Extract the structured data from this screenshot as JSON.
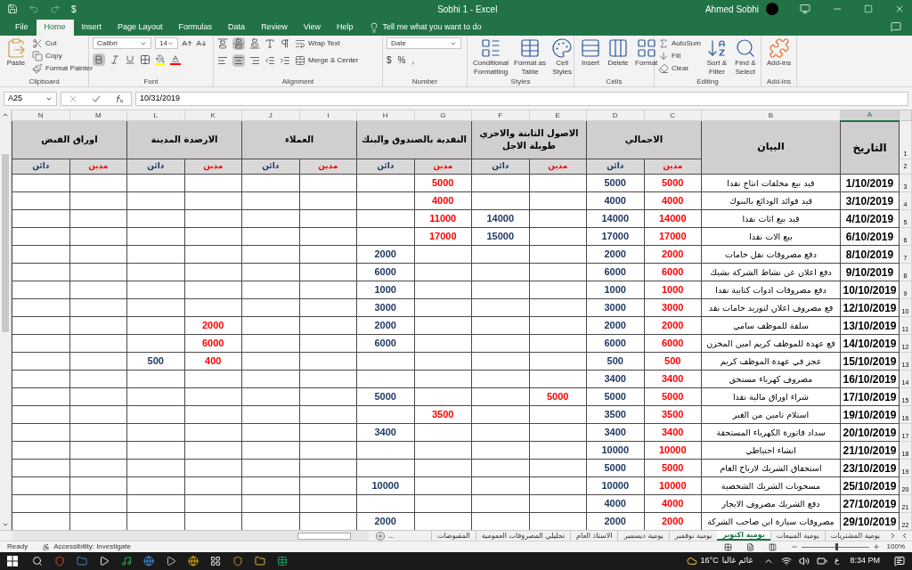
{
  "title_bar": {
    "currency_button": "$",
    "title": "Sobhi 1  -  Excel",
    "user": "Ahmed Sobhi"
  },
  "menu_tabs": [
    {
      "label": "File",
      "selected": false
    },
    {
      "label": "Home",
      "selected": true
    },
    {
      "label": "Insert",
      "selected": false
    },
    {
      "label": "Page Layout",
      "selected": false
    },
    {
      "label": "Formulas",
      "selected": false
    },
    {
      "label": "Data",
      "selected": false
    },
    {
      "label": "Review",
      "selected": false
    },
    {
      "label": "View",
      "selected": false
    },
    {
      "label": "Help",
      "selected": false
    }
  ],
  "tell_me": "Tell me what you want to do",
  "ribbon": {
    "clipboard": {
      "label": "Clipboard",
      "paste": "Paste",
      "cut": "Cut",
      "copy": "Copy",
      "format_painter": "Format Painter"
    },
    "font": {
      "label": "Font",
      "font_name": "Calibri",
      "font_size": "14",
      "bold": true
    },
    "alignment": {
      "label": "Alignment",
      "wrap_text": "Wrap Text",
      "merge_center": "Merge & Center",
      "align_middle": true,
      "align_center": true
    },
    "number": {
      "label": "Number",
      "format": "Date",
      "symbols": [
        "$",
        "%",
        ","
      ]
    },
    "styles": {
      "label": "Styles",
      "buttons": [
        [
          "Conditional",
          "Formatting"
        ],
        [
          "Format as",
          "Table"
        ],
        [
          "Cell",
          "Styles"
        ]
      ]
    },
    "cells": {
      "label": "Cells",
      "buttons": [
        "Insert",
        "Delete",
        "Format"
      ]
    },
    "editing": {
      "label": "Editing",
      "autosum": "AutoSum",
      "fill": "Fill",
      "clear": "Clear",
      "sort_filter": [
        "Sort &",
        "Filter"
      ],
      "find_select": [
        "Find &",
        "Select"
      ]
    },
    "addins": {
      "label": "Add-ins",
      "button": "Add-ins"
    }
  },
  "formula_bar": {
    "name_box": "A25",
    "value": "10/31/2019"
  },
  "sheet": {
    "columns": [
      {
        "letter": "N",
        "kind": "amount",
        "selected": false
      },
      {
        "letter": "M",
        "kind": "amount",
        "selected": false
      },
      {
        "letter": "L",
        "kind": "amount",
        "selected": false
      },
      {
        "letter": "K",
        "kind": "amount",
        "selected": false
      },
      {
        "letter": "J",
        "kind": "amount",
        "selected": false
      },
      {
        "letter": "I",
        "kind": "amount",
        "selected": false
      },
      {
        "letter": "H",
        "kind": "amount",
        "selected": false
      },
      {
        "letter": "G",
        "kind": "amount",
        "selected": false
      },
      {
        "letter": "F",
        "kind": "amount",
        "selected": false
      },
      {
        "letter": "E",
        "kind": "amount",
        "selected": false
      },
      {
        "letter": "D",
        "kind": "amount",
        "selected": false
      },
      {
        "letter": "C",
        "kind": "amount",
        "selected": false
      },
      {
        "letter": "B",
        "kind": "description",
        "selected": false
      },
      {
        "letter": "A",
        "kind": "date",
        "selected": true
      }
    ],
    "header_rows": [
      "1",
      "2"
    ],
    "date_header": "التاريخ",
    "description_header": "البيان",
    "groups": [
      {
        "label": "الاجمالي",
        "sub_headers": [
          {
            "label": "مدين",
            "kind": "debit"
          },
          {
            "label": "دائن",
            "kind": "credit"
          }
        ]
      },
      {
        "label": "الاصول الثابتة والاخري طويلة الاجل",
        "sub_headers": [
          {
            "label": "مدين",
            "kind": "debit"
          },
          {
            "label": "دائن",
            "kind": "credit"
          }
        ]
      },
      {
        "label": "النقدية بالصندوق والبنك",
        "sub_headers": [
          {
            "label": "مدين",
            "kind": "debit"
          },
          {
            "label": "دائن",
            "kind": "credit"
          }
        ]
      },
      {
        "label": "العملاء",
        "sub_headers": [
          {
            "label": "مدين",
            "kind": "debit"
          },
          {
            "label": "دائن",
            "kind": "credit"
          }
        ]
      },
      {
        "label": "الارصدة المدينة",
        "sub_headers": [
          {
            "label": "مدين",
            "kind": "debit"
          },
          {
            "label": "دائن",
            "kind": "credit"
          }
        ]
      },
      {
        "label": "اوراق القبض",
        "sub_headers": [
          {
            "label": "مدين",
            "kind": "debit"
          },
          {
            "label": "دائن",
            "kind": "credit"
          }
        ]
      }
    ],
    "rows": [
      {
        "row": "3",
        "date": "1/10/2019",
        "description": "قيد بيع مخلفات انتاج نقدا",
        "values": {
          "C": "5000",
          "D": "5000",
          "G": "5000"
        }
      },
      {
        "row": "4",
        "date": "3/10/2019",
        "description": "قيد فوائد الودائع بالبنوك",
        "values": {
          "C": "4000",
          "D": "4000",
          "G": "4000"
        }
      },
      {
        "row": "5",
        "date": "4/10/2019",
        "description": "قيد بيع اثاث نقدا",
        "values": {
          "C": "14000",
          "D": "14000",
          "F": "14000",
          "G": "11000"
        }
      },
      {
        "row": "6",
        "date": "6/10/2019",
        "description": "بيع الات نقدا",
        "values": {
          "C": "17000",
          "D": "17000",
          "F": "15000",
          "G": "17000"
        }
      },
      {
        "row": "7",
        "date": "8/10/2019",
        "description": "دفع مصروفات نقل خامات",
        "values": {
          "C": "2000",
          "D": "2000",
          "H": "2000"
        }
      },
      {
        "row": "8",
        "date": "9/10/2019",
        "description": "دفع اعلان عن نشاط الشركة بشيك",
        "values": {
          "C": "6000",
          "D": "6000",
          "H": "6000"
        }
      },
      {
        "row": "9",
        "date": "10/10/2019",
        "description": "دفع مصروفات ادوات كتابية نقدا",
        "values": {
          "C": "1000",
          "D": "1000",
          "H": "1000"
        }
      },
      {
        "row": "10",
        "date": "12/10/2019",
        "description": "فع مصروف اعلان لتوريد خامات نقد",
        "values": {
          "C": "3000",
          "D": "3000",
          "H": "3000"
        }
      },
      {
        "row": "11",
        "date": "13/10/2019",
        "description": "سلفة للموظف سامي",
        "values": {
          "C": "2000",
          "D": "2000",
          "H": "2000",
          "K": "2000"
        }
      },
      {
        "row": "12",
        "date": "14/10/2019",
        "description": "فع عهدة للموظف كريم امين المخزن",
        "values": {
          "C": "6000",
          "D": "6000",
          "H": "6000",
          "K": "6000"
        }
      },
      {
        "row": "13",
        "date": "15/10/2019",
        "description": "عجز في عهدة الموظف كريم",
        "values": {
          "C": "500",
          "D": "500",
          "K": "400",
          "L": "500"
        }
      },
      {
        "row": "14",
        "date": "16/10/2019",
        "description": "مصروف كهرباء مستحق",
        "values": {
          "C": "3400",
          "D": "3400"
        }
      },
      {
        "row": "15",
        "date": "17/10/2019",
        "description": "شراء اوراق مالية نقدا",
        "values": {
          "C": "5000",
          "D": "5000",
          "E": "5000",
          "H": "5000"
        }
      },
      {
        "row": "16",
        "date": "19/10/2019",
        "description": "استلام تامين من الغير",
        "values": {
          "C": "3500",
          "D": "3500",
          "G": "3500"
        }
      },
      {
        "row": "17",
        "date": "20/10/2019",
        "description": "سداد فاتورة الكهرباء المستحقة",
        "values": {
          "C": "3400",
          "D": "3400",
          "H": "3400"
        }
      },
      {
        "row": "18",
        "date": "21/10/2019",
        "description": "انشاء احتياطي",
        "values": {
          "C": "10000",
          "D": "10000"
        }
      },
      {
        "row": "19",
        "date": "23/10/2019",
        "description": "استحقاق الشريك لارباح العام",
        "values": {
          "C": "5000",
          "D": "5000"
        }
      },
      {
        "row": "20",
        "date": "25/10/2019",
        "description": "مسحوبات الشريك الشخصية",
        "values": {
          "C": "10000",
          "D": "10000",
          "H": "10000"
        }
      },
      {
        "row": "21",
        "date": "27/10/2019",
        "description": "دفع الشريك مصروف الايجار",
        "values": {
          "C": "4000",
          "D": "4000"
        }
      },
      {
        "row": "22",
        "date": "29/10/2019",
        "description": "مصروفات سيارة ابن صاحب الشركة",
        "values": {
          "C": "2000",
          "D": "2000",
          "H": "2000"
        }
      }
    ]
  },
  "sheet_tabs": {
    "more": "...",
    "tabs": [
      {
        "label": "يومية المشتريات",
        "selected": false
      },
      {
        "label": "يومية المبيعات",
        "selected": false
      },
      {
        "label": "يومية اكتوبر",
        "selected": true
      },
      {
        "label": "يومية نوفمبر",
        "selected": false
      },
      {
        "label": "يومية ديسمبر",
        "selected": false
      },
      {
        "label": "الاستاذ العام",
        "selected": false
      },
      {
        "label": "تحليلي المصروفات العمومية",
        "selected": false
      },
      {
        "label": "المقبوضات",
        "selected": false
      }
    ]
  },
  "status_bar": {
    "mode": "Ready",
    "accessibility": "Accessibility: Investigate",
    "zoom": "100%",
    "zoom_slider": {
      "level": 0.5
    }
  },
  "taskbar": {
    "temperature": "16°C",
    "weather": "غائم غالبا",
    "language": "ع",
    "time": "8:34 PM"
  }
}
